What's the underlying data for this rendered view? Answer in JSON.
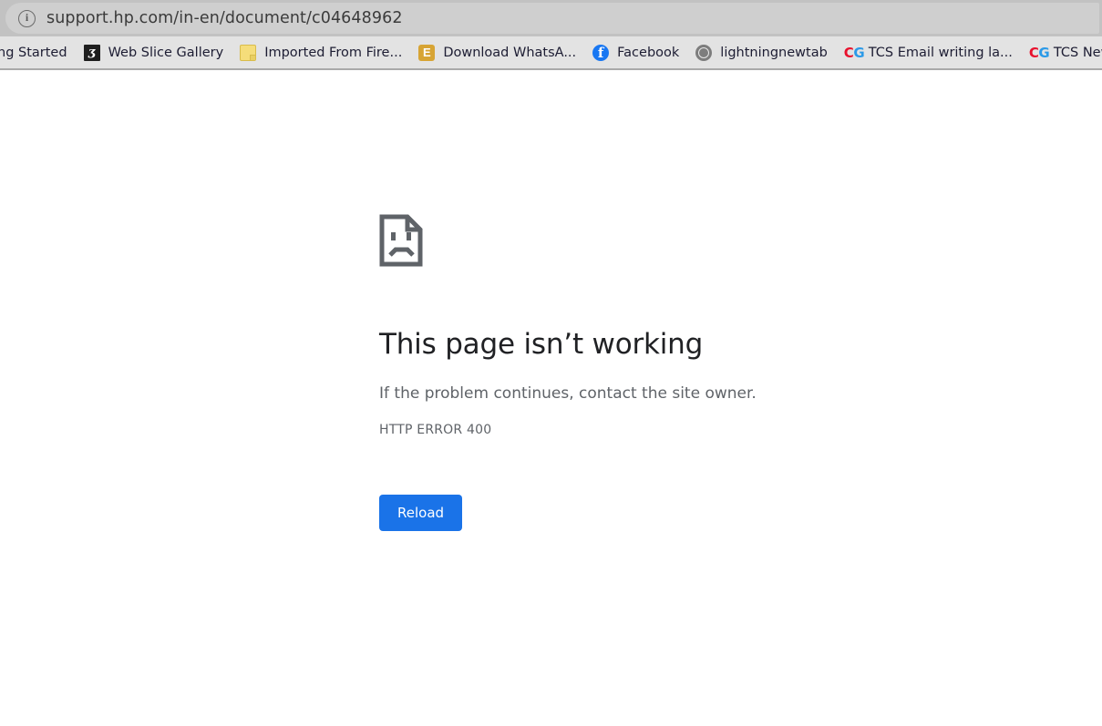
{
  "browser": {
    "omnibox": {
      "icon": "info-circle-icon",
      "icon_glyph": "i",
      "url": "support.hp.com/in-en/document/c04648962"
    },
    "bookmarks": [
      {
        "label": "ng Started",
        "icon": "none",
        "icon_glyph": ""
      },
      {
        "label": "Web Slice Gallery",
        "icon": "web-slice-gallery-icon",
        "icon_glyph": "ʒ"
      },
      {
        "label": "Imported From Fire...",
        "icon": "folder-icon",
        "icon_glyph": ""
      },
      {
        "label": "Download WhatsA...",
        "icon": "evernote-e-icon",
        "icon_glyph": "E"
      },
      {
        "label": "Facebook",
        "icon": "facebook-icon",
        "icon_glyph": "f"
      },
      {
        "label": "lightningnewtab",
        "icon": "globe-icon",
        "icon_glyph": ""
      },
      {
        "label": "TCS Email writing la...",
        "icon": "cg-icon",
        "icon_glyph": "CG"
      },
      {
        "label": "TCS New Ve",
        "icon": "cg-icon",
        "icon_glyph": "CG"
      }
    ]
  },
  "error_page": {
    "icon": "sad-document-icon",
    "title": "This page isn’t working",
    "subtitle": "If the problem continues, contact the site owner.",
    "code": "HTTP ERROR 400",
    "reload_label": "Reload"
  },
  "colors": {
    "chrome_toolbar": "#c2c2c2",
    "omnibox": "#cfcfcf",
    "bookmarks_bar": "#e3e3e3",
    "accent_button": "#1a73e8",
    "title_text": "#202124",
    "secondary_text": "#5f6368"
  }
}
